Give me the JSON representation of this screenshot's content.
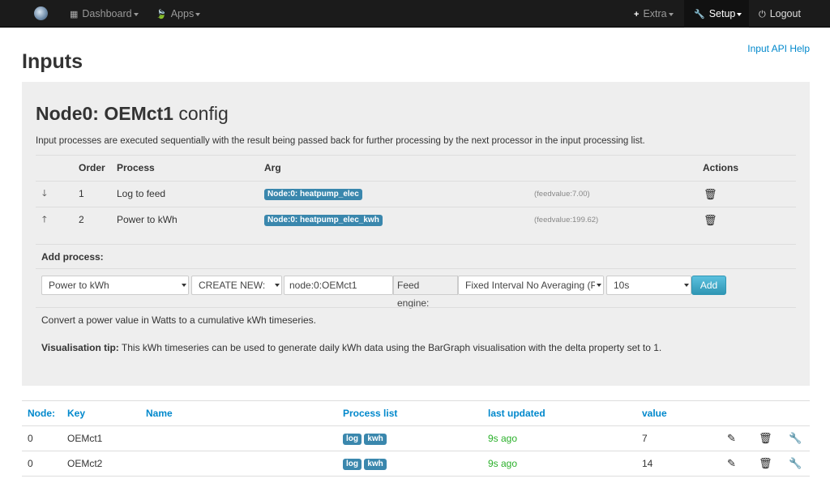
{
  "navbar": {
    "logo_icon": "emoncms-logo-icon",
    "dashboard": "Dashboard",
    "apps": "Apps",
    "extra": "Extra",
    "setup": "Setup",
    "logout": "Logout"
  },
  "header": {
    "api_help": "Input API Help",
    "page_title": "Inputs"
  },
  "config": {
    "title_bold": "Node0: OEMct1",
    "title_rest": " config",
    "description": "Input processes are executed sequentially with the result being passed back for further processing by the next processor in the input processing list.",
    "columns": {
      "order": "Order",
      "process": "Process",
      "arg": "Arg",
      "actions": "Actions"
    },
    "processes": [
      {
        "move_icon": "arrow-down-icon",
        "move_glyph": "🡓",
        "order": "1",
        "process": "Log to feed",
        "arg": "Node:0: heatpump_elec",
        "feedvalue": "(feedvalue:7.00)"
      },
      {
        "move_icon": "arrow-up-icon",
        "move_glyph": "🡑",
        "order": "2",
        "process": "Power to kWh",
        "arg": "Node:0: heatpump_elec_kwh",
        "feedvalue": "(feedvalue:199.62)"
      }
    ],
    "add_process": {
      "title": "Add process:",
      "process_select": "Power to kWh",
      "feed_select": "CREATE NEW:",
      "feed_name": "node:0:OEMct1",
      "engine_label": "Feed engine:",
      "engine_select": "Fixed Interval No Averaging (PHPFINA)",
      "interval_select": "10s",
      "add_button": "Add"
    },
    "process_description": "Convert a power value in Watts to a cumulative kWh timeseries.",
    "tip_label": "Visualisation tip:",
    "tip_text": " This kWh timeseries can be used to generate daily kWh data using the BarGraph visualisation with the delta property set to 1."
  },
  "inputs": {
    "columns": {
      "node": "Node:",
      "key": "Key",
      "name": "Name",
      "process_list": "Process list",
      "last_updated": "last updated",
      "value": "value"
    },
    "rows": [
      {
        "node": "0",
        "key": "OEMct1",
        "name": "",
        "tags": [
          "log",
          "kwh"
        ],
        "updated": "9s ago",
        "value": "7"
      },
      {
        "node": "0",
        "key": "OEMct2",
        "name": "",
        "tags": [
          "log",
          "kwh"
        ],
        "updated": "9s ago",
        "value": "14"
      }
    ]
  }
}
